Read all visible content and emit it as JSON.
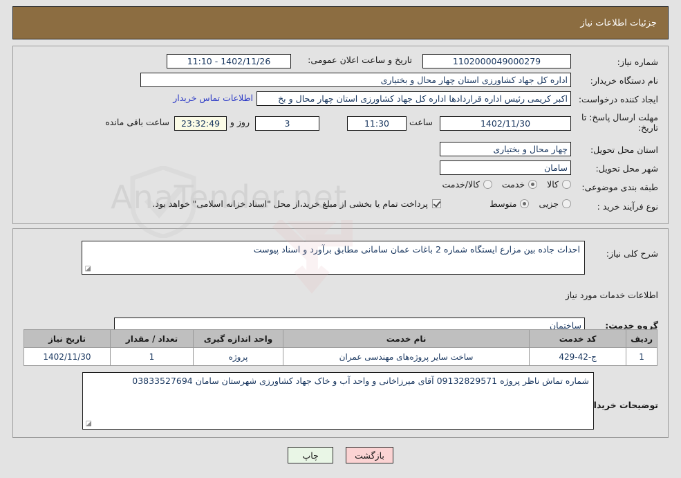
{
  "header": {
    "title": "جزئیات اطلاعات نیاز"
  },
  "colors": {
    "header_bg": "#8c6d41",
    "page_bg": "#e3e3e3",
    "link": "#2b39c6",
    "field_text": "#17355e",
    "table_header_bg": "#bfbfbf",
    "print_button_bg": "#e9f6e6",
    "back_button_bg": "#fbd3d3",
    "countdown_bg": "#fbfbe6"
  },
  "form": {
    "need_number": {
      "label": "شماره نیاز:",
      "value": "1102000049000279"
    },
    "announce_datetime": {
      "label": "تاریخ و ساعت اعلان عمومی:",
      "value": "1402/11/26 - 11:10"
    },
    "buyer_org": {
      "label": "نام دستگاه خریدار:",
      "value": "اداره کل جهاد کشاورزی استان چهار محال و بختیاری"
    },
    "request_creator": {
      "label": "ایجاد کننده درخواست:",
      "value": "اکبر کریمی رئیس اداره قراردادها اداره کل جهاد کشاورزی استان چهار محال و بخ",
      "contact_link": "اطلاعات تماس خریدار"
    },
    "response_deadline": {
      "label": "مهلت ارسال پاسخ: تا تاریخ:",
      "date": "1402/11/30",
      "time_label": "ساعت",
      "time": "11:30",
      "days": "3",
      "days_label": "روز و",
      "countdown": "23:32:49",
      "remaining_label": "ساعت باقی مانده"
    },
    "delivery_province": {
      "label": "استان محل تحویل:",
      "value": "چهار محال و بختیاری"
    },
    "delivery_city": {
      "label": "شهر محل تحویل:",
      "value": "سامان"
    },
    "subject_category": {
      "label": "طبقه بندی موضوعی:",
      "options": [
        "کالا",
        "خدمت",
        "کالا/خدمت"
      ],
      "selected": "خدمت"
    },
    "purchase_process": {
      "label": "نوع فرآیند خرید :",
      "options": [
        "جزیی",
        "متوسط"
      ],
      "selected": "متوسط"
    },
    "treasury_note": {
      "checked": true,
      "text": "پرداخت تمام یا بخشی از مبلغ خرید،از محل \"اسناد خزانه اسلامی\" خواهد بود."
    }
  },
  "details": {
    "general_description": {
      "label": "شرح کلی نیاز:",
      "value": "احداث جاده بین مزارع ایستگاه شماره 2 باغات عمان سامانی مطابق برآورد و اسناد پیوست"
    },
    "services_section_title": "اطلاعات خدمات مورد نیاز",
    "service_group": {
      "label": "گروه خدمت:",
      "value": "ساختمان"
    },
    "table": {
      "columns": [
        "ردیف",
        "کد خدمت",
        "نام خدمت",
        "واحد اندازه گیری",
        "تعداد / مقدار",
        "تاریخ نیاز"
      ],
      "rows": [
        {
          "row_no": "1",
          "service_code": "ج-42-429",
          "service_name": "ساخت سایر پروژه‌های مهندسی عمران",
          "unit": "پروژه",
          "quantity": "1",
          "need_date": "1402/11/30"
        }
      ]
    },
    "buyer_notes": {
      "label": "توضیحات خریدار:",
      "value": "شماره تماش ناظر پروژه 09132829571 آقای میرزاخانی و واحد آب و خاک جهاد کشاورزی شهرستان سامان 03833527694"
    }
  },
  "buttons": {
    "print": "چاپ",
    "back": "بازگشت"
  },
  "watermark": {
    "text": "AnaTender.net"
  }
}
